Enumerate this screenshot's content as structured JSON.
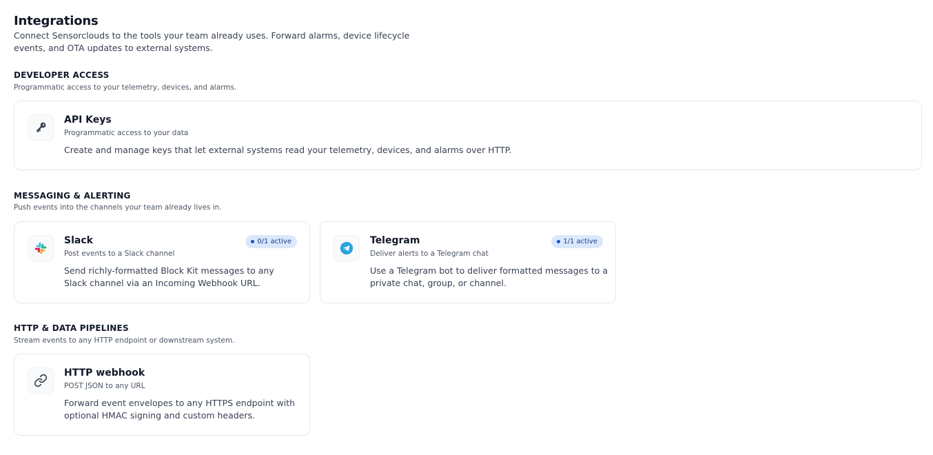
{
  "header": {
    "title": "Integrations",
    "description": "Connect Sensorclouds to the tools your team already uses. Forward alarms, device lifecycle events, and OTA updates to external systems."
  },
  "sections": [
    {
      "title": "DEVELOPER ACCESS",
      "subtitle": "Programmatic access to your telemetry, devices, and alarms.",
      "cards": [
        {
          "title": "API Keys",
          "subtitle": "Programmatic access to your data",
          "description": "Create and manage keys that let external systems read your telemetry, devices, and alarms over HTTP.",
          "icon": "key-icon"
        }
      ]
    },
    {
      "title": "MESSAGING & ALERTING",
      "subtitle": "Push events into the channels your team already lives in.",
      "cards": [
        {
          "title": "Slack",
          "subtitle": "Post events to a Slack channel",
          "description": "Send richly-formatted Block Kit messages to any Slack channel via an Incoming Webhook URL.",
          "badge": "0/1 active",
          "icon": "slack-icon"
        },
        {
          "title": "Telegram",
          "subtitle": "Deliver alerts to a Telegram chat",
          "description": "Use a Telegram bot to deliver formatted messages to a private chat, group, or channel.",
          "badge": "1/1 active",
          "icon": "telegram-icon"
        }
      ]
    },
    {
      "title": "HTTP & DATA PIPELINES",
      "subtitle": "Stream events to any HTTP endpoint or downstream system.",
      "cards": [
        {
          "title": "HTTP webhook",
          "subtitle": "POST JSON to any URL",
          "description": "Forward event envelopes to any HTTPS endpoint with optional HMAC signing and custom headers.",
          "icon": "link-icon"
        }
      ]
    }
  ],
  "colors": {
    "badge_bg": "#dbe8fb",
    "badge_text": "#1e3a8a",
    "telegram": "#2aa3df",
    "border": "#e5e7eb"
  }
}
